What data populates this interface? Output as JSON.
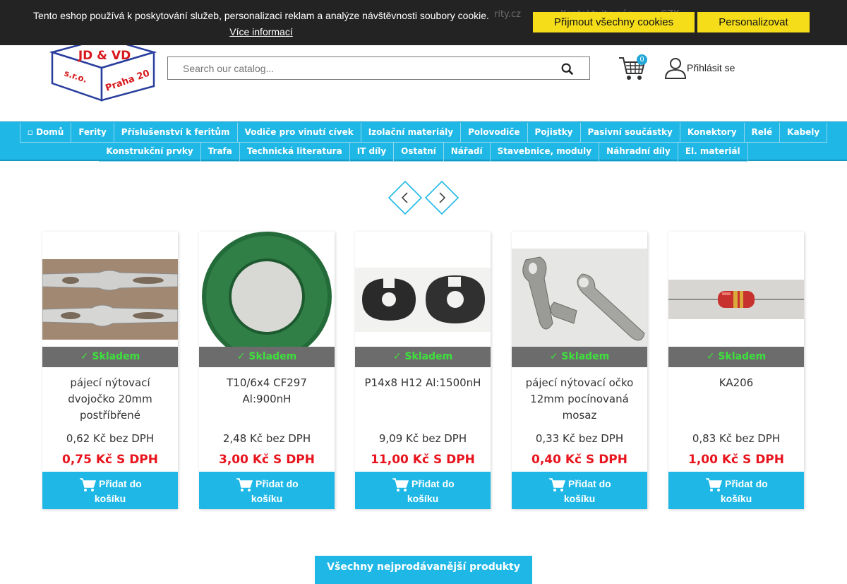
{
  "cookie": {
    "text": "Tento eshop používá k poskytování služeb, personalizaci reklam a analýze návštěvnosti soubory cookie.",
    "link": "Více informací",
    "accept_label": "Přijmout všechny cookies",
    "personalize_label": "Personalizovat"
  },
  "topbar": {
    "email_fragment": "rity.cz",
    "contact": "Kontaktujte nás",
    "currency": "CZK"
  },
  "logo": {
    "line1": "JD & VD",
    "line2": "s.r.o.",
    "line3": "Praha 20"
  },
  "search": {
    "placeholder": "Search our catalog..."
  },
  "cart": {
    "count": "0"
  },
  "account": {
    "login_label": "Přihlásit se"
  },
  "nav": {
    "row1": [
      "Domů",
      "Ferity",
      "Příslušenství k feritům",
      "Vodiče pro vinutí cívek",
      "Izolační materiály",
      "Polovodiče",
      "Pojistky",
      "Pasivní součástky",
      "Konektory",
      "Relé",
      "Kabely"
    ],
    "row2": [
      "Konstrukční prvky",
      "Trafa",
      "Technická literatura",
      "IT díly",
      "Ostatní",
      "Nářadí",
      "Stavebnice, moduly",
      "Náhradní díly",
      "El. materiál"
    ]
  },
  "products": [
    {
      "stock": "Skladem",
      "name": "pájecí nýtovací dvojočko 20mm postříbřené",
      "price_net": "0,62 Kč bez DPH",
      "price_vat": "0,75 Kč S DPH",
      "btn1": "Přidat do",
      "btn2": "košíku"
    },
    {
      "stock": "Skladem",
      "name": "T10/6x4 CF297 Al:900nH",
      "price_net": "2,48 Kč bez DPH",
      "price_vat": "3,00 Kč S DPH",
      "btn1": "Přidat do",
      "btn2": "košíku"
    },
    {
      "stock": "Skladem",
      "name": "P14x8 H12 Al:1500nH",
      "price_net": "9,09 Kč bez DPH",
      "price_vat": "11,00 Kč S DPH",
      "btn1": "Přidat do",
      "btn2": "košíku"
    },
    {
      "stock": "Skladem",
      "name": "pájecí nýtovací očko 12mm pocínovaná mosaz",
      "price_net": "0,33 Kč bez DPH",
      "price_vat": "0,40 Kč S DPH",
      "btn1": "Přidat do",
      "btn2": "košíku"
    },
    {
      "stock": "Skladem",
      "name": "KA206",
      "price_net": "0,83 Kč bez DPH",
      "price_vat": "1,00 Kč S DPH",
      "btn1": "Přidat do",
      "btn2": "košíku"
    }
  ],
  "all_products_label": "Všechny nejprodávanější produkty",
  "colors": {
    "accent": "#1fb8e6",
    "price": "#e8141e",
    "cookie_button": "#f5dd1a",
    "stock": "#3de23d"
  }
}
